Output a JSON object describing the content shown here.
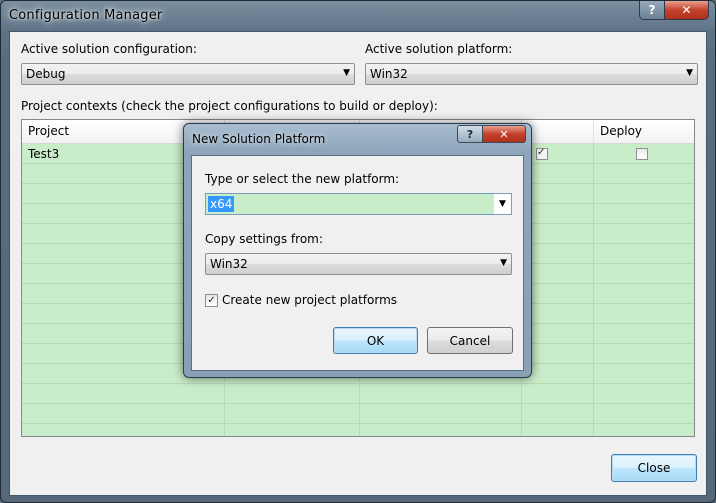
{
  "window": {
    "title": "Configuration Manager",
    "help_glyph": "?",
    "close_glyph": "✕"
  },
  "main": {
    "active_config_label": "Active solution configuration:",
    "active_config_value": "Debug",
    "active_platform_label": "Active solution platform:",
    "active_platform_value": "Win32",
    "contexts_label": "Project contexts (check the project configurations to build or deploy):",
    "columns": [
      "Project",
      "",
      "",
      "",
      "Deploy"
    ],
    "rows": [
      {
        "project": "Test3",
        "build_checked": true,
        "deploy_checked": false
      }
    ],
    "close_label": "Close"
  },
  "dialog": {
    "title": "New Solution Platform",
    "help_glyph": "?",
    "close_glyph": "✕",
    "platform_label": "Type or select the new platform:",
    "platform_value": "x64",
    "copy_label": "Copy settings from:",
    "copy_value": "Win32",
    "create_label": "Create new project platforms",
    "create_checked": true,
    "ok_label": "OK",
    "cancel_label": "Cancel"
  },
  "icons": {
    "dropdown_arrow": "▼",
    "check_mark": "✓"
  }
}
